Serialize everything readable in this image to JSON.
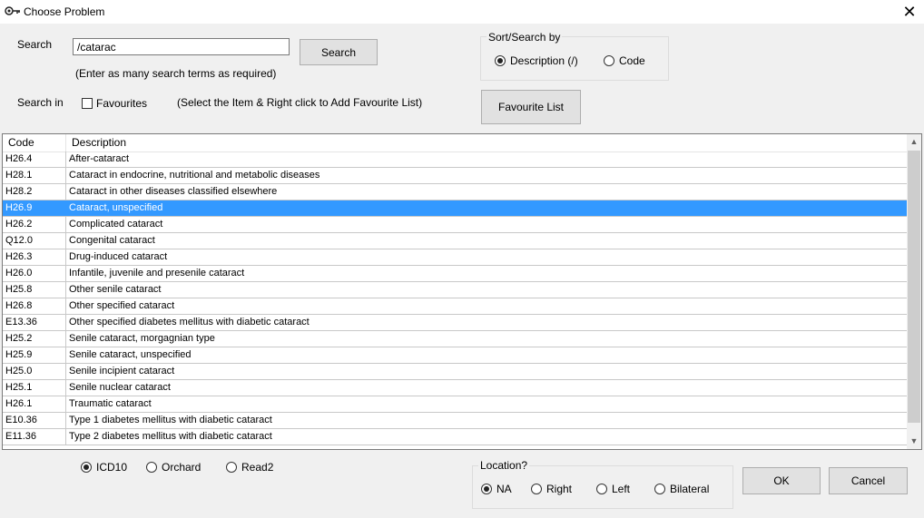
{
  "window": {
    "title": "Choose Problem",
    "close_glyph": "✕",
    "icon": "stethoscope-icon"
  },
  "search": {
    "label": "Search",
    "value": "/catarac",
    "button": "Search",
    "hint": "(Enter as many search terms as required)"
  },
  "search_in": {
    "label": "Search in",
    "favourites_label": "Favourites",
    "favourites_checked": false,
    "hint": "(Select the Item & Right click to Add Favourite List)"
  },
  "sort": {
    "title": "Sort/Search by",
    "options": [
      {
        "label": "Description (/)",
        "selected": true
      },
      {
        "label": "Code",
        "selected": false
      }
    ]
  },
  "favourite_list_button": "Favourite List",
  "table": {
    "columns": [
      "Code",
      "Description"
    ],
    "selected_index": 3,
    "rows": [
      {
        "code": "H26.4",
        "desc": "After-cataract"
      },
      {
        "code": "H28.1",
        "desc": "Cataract in endocrine, nutritional and metabolic diseases"
      },
      {
        "code": "H28.2",
        "desc": "Cataract in other diseases classified elsewhere"
      },
      {
        "code": "H26.9",
        "desc": "Cataract, unspecified"
      },
      {
        "code": "H26.2",
        "desc": "Complicated cataract"
      },
      {
        "code": "Q12.0",
        "desc": "Congenital cataract"
      },
      {
        "code": "H26.3",
        "desc": "Drug-induced cataract"
      },
      {
        "code": "H26.0",
        "desc": "Infantile, juvenile and presenile cataract"
      },
      {
        "code": "H25.8",
        "desc": "Other senile cataract"
      },
      {
        "code": "H26.8",
        "desc": "Other specified cataract"
      },
      {
        "code": "E13.36",
        "desc": "Other specified diabetes mellitus with diabetic cataract"
      },
      {
        "code": "H25.2",
        "desc": "Senile cataract, morgagnian type"
      },
      {
        "code": "H25.9",
        "desc": "Senile cataract, unspecified"
      },
      {
        "code": "H25.0",
        "desc": "Senile incipient cataract"
      },
      {
        "code": "H25.1",
        "desc": "Senile nuclear cataract"
      },
      {
        "code": "H26.1",
        "desc": "Traumatic cataract"
      },
      {
        "code": "E10.36",
        "desc": "Type 1 diabetes mellitus with diabetic cataract"
      },
      {
        "code": "E11.36",
        "desc": "Type 2 diabetes mellitus with diabetic cataract"
      }
    ]
  },
  "coding": {
    "options": [
      {
        "label": "ICD10",
        "selected": true
      },
      {
        "label": "Orchard",
        "selected": false
      },
      {
        "label": "Read2",
        "selected": false
      }
    ]
  },
  "location": {
    "title": "Location?",
    "options": [
      {
        "label": "NA",
        "selected": true
      },
      {
        "label": "Right",
        "selected": false
      },
      {
        "label": "Left",
        "selected": false
      },
      {
        "label": "Bilateral",
        "selected": false
      }
    ]
  },
  "buttons": {
    "ok": "OK",
    "cancel": "Cancel"
  },
  "colors": {
    "selection": "#3399ff",
    "dialog_bg": "#f0f0f0"
  }
}
